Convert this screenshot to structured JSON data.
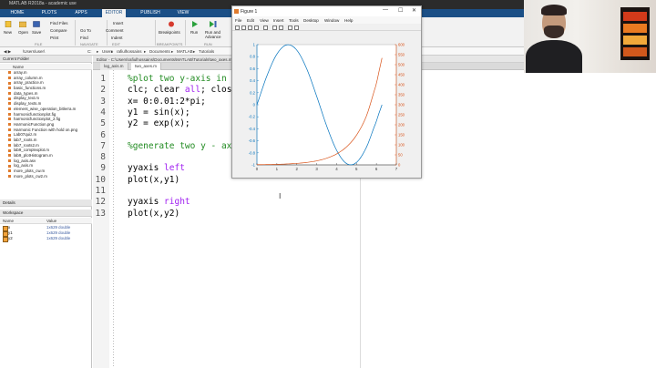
{
  "app": {
    "title": "MATLAB R2018a - academic use"
  },
  "ribbon": {
    "tabs": [
      "HOME",
      "PLOTS",
      "APPS",
      "EDITOR",
      "PUBLISH",
      "VIEW"
    ],
    "active_tab": "EDITOR",
    "file_section": {
      "new": "New",
      "open": "Open",
      "save": "Save",
      "find_files": "Find Files",
      "compare": "Compare",
      "print": "Print",
      "label": "FILE"
    },
    "navigate_section": {
      "go_to": "Go To",
      "find": "Find",
      "label": "NAVIGATE"
    },
    "edit_section": {
      "insert": "Insert",
      "comment": "Comment",
      "indent": "Indent",
      "label": "EDIT"
    },
    "breakpoints_section": {
      "breakpoints": "Breakpoints",
      "label": "BREAKPOINTS"
    },
    "run_section": {
      "run": "Run",
      "run_and_advance": "Run and Advance",
      "label": "RUN"
    }
  },
  "address_bar": {
    "path": [
      "C:",
      "Users",
      "rafiulhossains",
      "Documents",
      "MATLAB",
      "Tutorials"
    ],
    "left_path": "\\Users\\user\\"
  },
  "current_folder": {
    "header": "Current Folder",
    "column": "Name",
    "files": [
      "array.m",
      "array_column.m",
      "array_practice.m",
      "basic_functions.m",
      "data_types.m",
      "display_text.m",
      "display_texts.m",
      "element_wise_operation_bitlerra.m",
      "harmonicfunctionplot.fig",
      "harmonicfunctionplot_2.fig",
      "HarmonicFunction.png",
      "Harmonic Function with hold on.png",
      "Lab07quiz.m",
      "lab7_roots.m",
      "lab7_roots2.m",
      "lab9_complexplot.m",
      "lab9_plotHistogram.m",
      "log_axis.asv",
      "log_axis.m",
      "more_plots_cw.m",
      "more_plots_cw2.m"
    ]
  },
  "details": {
    "header": "Details"
  },
  "workspace": {
    "header": "Workspace",
    "col_name": "Name",
    "col_value": "Value",
    "vars": [
      {
        "name": "x",
        "value": "1x629 double"
      },
      {
        "name": "y1",
        "value": "1x629 double"
      },
      {
        "name": "y2",
        "value": "1x629 double"
      }
    ]
  },
  "editor": {
    "header": "Editor - C:\\Users\\rafiulhossains\\Documents\\MATLAB\\Tutorials\\two_axes.m",
    "tabs": [
      "log_axis.m",
      "two_axes.m"
    ],
    "active_tab": "two_axes.m",
    "lines": [
      {
        "num": "1",
        "text": "%plot two y-axis in a figure"
      },
      {
        "num": "2",
        "pre": "clc; clear ",
        "kw": "all",
        "post": "; close all"
      },
      {
        "num": "3",
        "text": "x= 0:0.01:2*pi;"
      },
      {
        "num": "4",
        "text": "y1 = sin(x);"
      },
      {
        "num": "5",
        "text": "y2 = exp(x);"
      },
      {
        "num": "6",
        "text": ""
      },
      {
        "num": "7",
        "text": "%generate two y - axes"
      },
      {
        "num": "8",
        "text": ""
      },
      {
        "num": "9",
        "pre": "yyaxis ",
        "kw": "left"
      },
      {
        "num": "10",
        "text": "plot(x,y1)"
      },
      {
        "num": "11",
        "text": ""
      },
      {
        "num": "12",
        "pre": "yyaxis ",
        "kw": "right"
      },
      {
        "num": "13",
        "text": "plot(x,y2)"
      }
    ]
  },
  "figure": {
    "title": "Figure 1",
    "menu": [
      "File",
      "Edit",
      "View",
      "Insert",
      "Tools",
      "Desktop",
      "Window",
      "Help"
    ],
    "window_buttons": {
      "minimize": "—",
      "maximize": "☐",
      "close": "✕"
    }
  },
  "chart_data": {
    "type": "line",
    "title": "",
    "xlabel": "",
    "ylabel_left": "",
    "ylabel_right": "",
    "xlim": [
      0,
      7
    ],
    "ylim_left": [
      -1,
      1
    ],
    "ylim_right": [
      0,
      600
    ],
    "xticks": [
      0,
      1,
      2,
      3,
      4,
      5,
      6,
      7
    ],
    "yticks_left": [
      -1,
      -0.8,
      -0.6,
      -0.4,
      -0.2,
      0,
      0.2,
      0.4,
      0.6,
      0.8,
      1
    ],
    "yticks_right": [
      0,
      50,
      100,
      150,
      200,
      250,
      300,
      350,
      400,
      450,
      500,
      550,
      600
    ],
    "left_color": "#0072bd",
    "right_color": "#d95319",
    "series": [
      {
        "axis": "left",
        "color": "#0072bd",
        "x": [
          0,
          0.5,
          1,
          1.5,
          2,
          2.5,
          3,
          3.5,
          4,
          4.5,
          5,
          5.5,
          6,
          6.28
        ],
        "y": [
          0,
          0.479,
          0.841,
          0.997,
          0.909,
          0.598,
          0.141,
          -0.351,
          -0.757,
          -0.978,
          -0.959,
          -0.706,
          -0.279,
          0
        ]
      },
      {
        "axis": "right",
        "color": "#d95319",
        "x": [
          0,
          0.5,
          1,
          1.5,
          2,
          2.5,
          3,
          3.5,
          4,
          4.5,
          5,
          5.5,
          6,
          6.28
        ],
        "y": [
          1,
          1.65,
          2.72,
          4.48,
          7.39,
          12.18,
          20.09,
          33.12,
          54.6,
          90.02,
          148.41,
          244.69,
          403.43,
          533.5
        ]
      }
    ],
    "grid": false
  }
}
